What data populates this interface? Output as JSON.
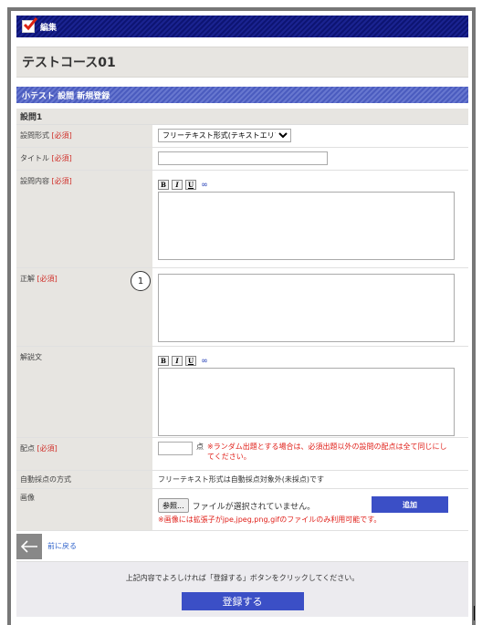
{
  "header": {
    "title": "編集"
  },
  "course": {
    "name": "テストコース01"
  },
  "subheader": {
    "title": "小テスト 設問 新規登録"
  },
  "section": {
    "title": "設問1"
  },
  "form": {
    "question_type": {
      "label": "設問形式",
      "required": "[必須]",
      "selected": "フリーテキスト形式(テキストエリア)"
    },
    "title": {
      "label": "タイトル",
      "required": "[必須]",
      "value": ""
    },
    "content": {
      "label": "設問内容",
      "required": "[必須]"
    },
    "answer": {
      "label": "正解",
      "required": "[必須]",
      "marker": "1"
    },
    "explanation": {
      "label": "解説文"
    },
    "points": {
      "label": "配点",
      "required": "[必須]",
      "unit": "点",
      "note": "※ランダム出題とする場合は、必須出題以外の設問の配点は全て同じにしてください。"
    },
    "auto_grade": {
      "label": "自動採点の方式",
      "value": "フリーテキスト形式は自動採点対象外(未採点)です"
    },
    "image": {
      "label": "画像",
      "browse": "参照...",
      "no_file": "ファイルが選択されていません。",
      "note": "※画像には拡張子がjpe,jpeg,png,gifのファイルのみ利用可能です。",
      "add": "追加"
    }
  },
  "editor_tools": [
    "B",
    "I",
    "U",
    "∞"
  ],
  "nav": {
    "back": "前に戻る"
  },
  "footer": {
    "message": "上記内容でよろしければ「登録する」ボタンをクリックしてください。",
    "submit": "登録する"
  }
}
